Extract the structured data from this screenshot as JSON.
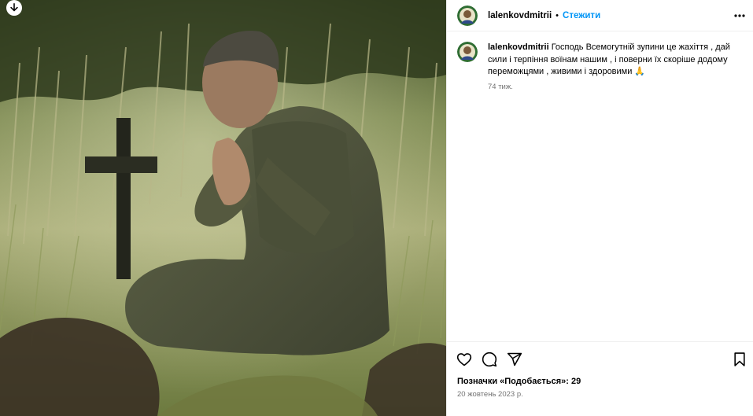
{
  "media": {
    "download_icon": "arrow-down-icon"
  },
  "header": {
    "username": "lalenkovdmitrii",
    "dot": "•",
    "follow_label": "Стежити",
    "more_icon": "more-horizontal-icon"
  },
  "caption": {
    "username": "lalenkovdmitrii",
    "text": " Господь Всемогутній зупини це жахіття , дай сили і терпіння воїнам нашим , і поверни їх скоріше додому переможцями , живими і здоровими 🙏",
    "time": "74 тиж."
  },
  "actions": {
    "like_icon": "heart-icon",
    "comment_icon": "comment-icon",
    "share_icon": "send-icon",
    "save_icon": "bookmark-icon"
  },
  "likes": {
    "label": "Позначки «Подобається»: ",
    "count": "29"
  },
  "date": "20 жовтень 2023 р.",
  "colors": {
    "accent": "#0095f6",
    "muted": "#737373",
    "border": "#efefef"
  }
}
